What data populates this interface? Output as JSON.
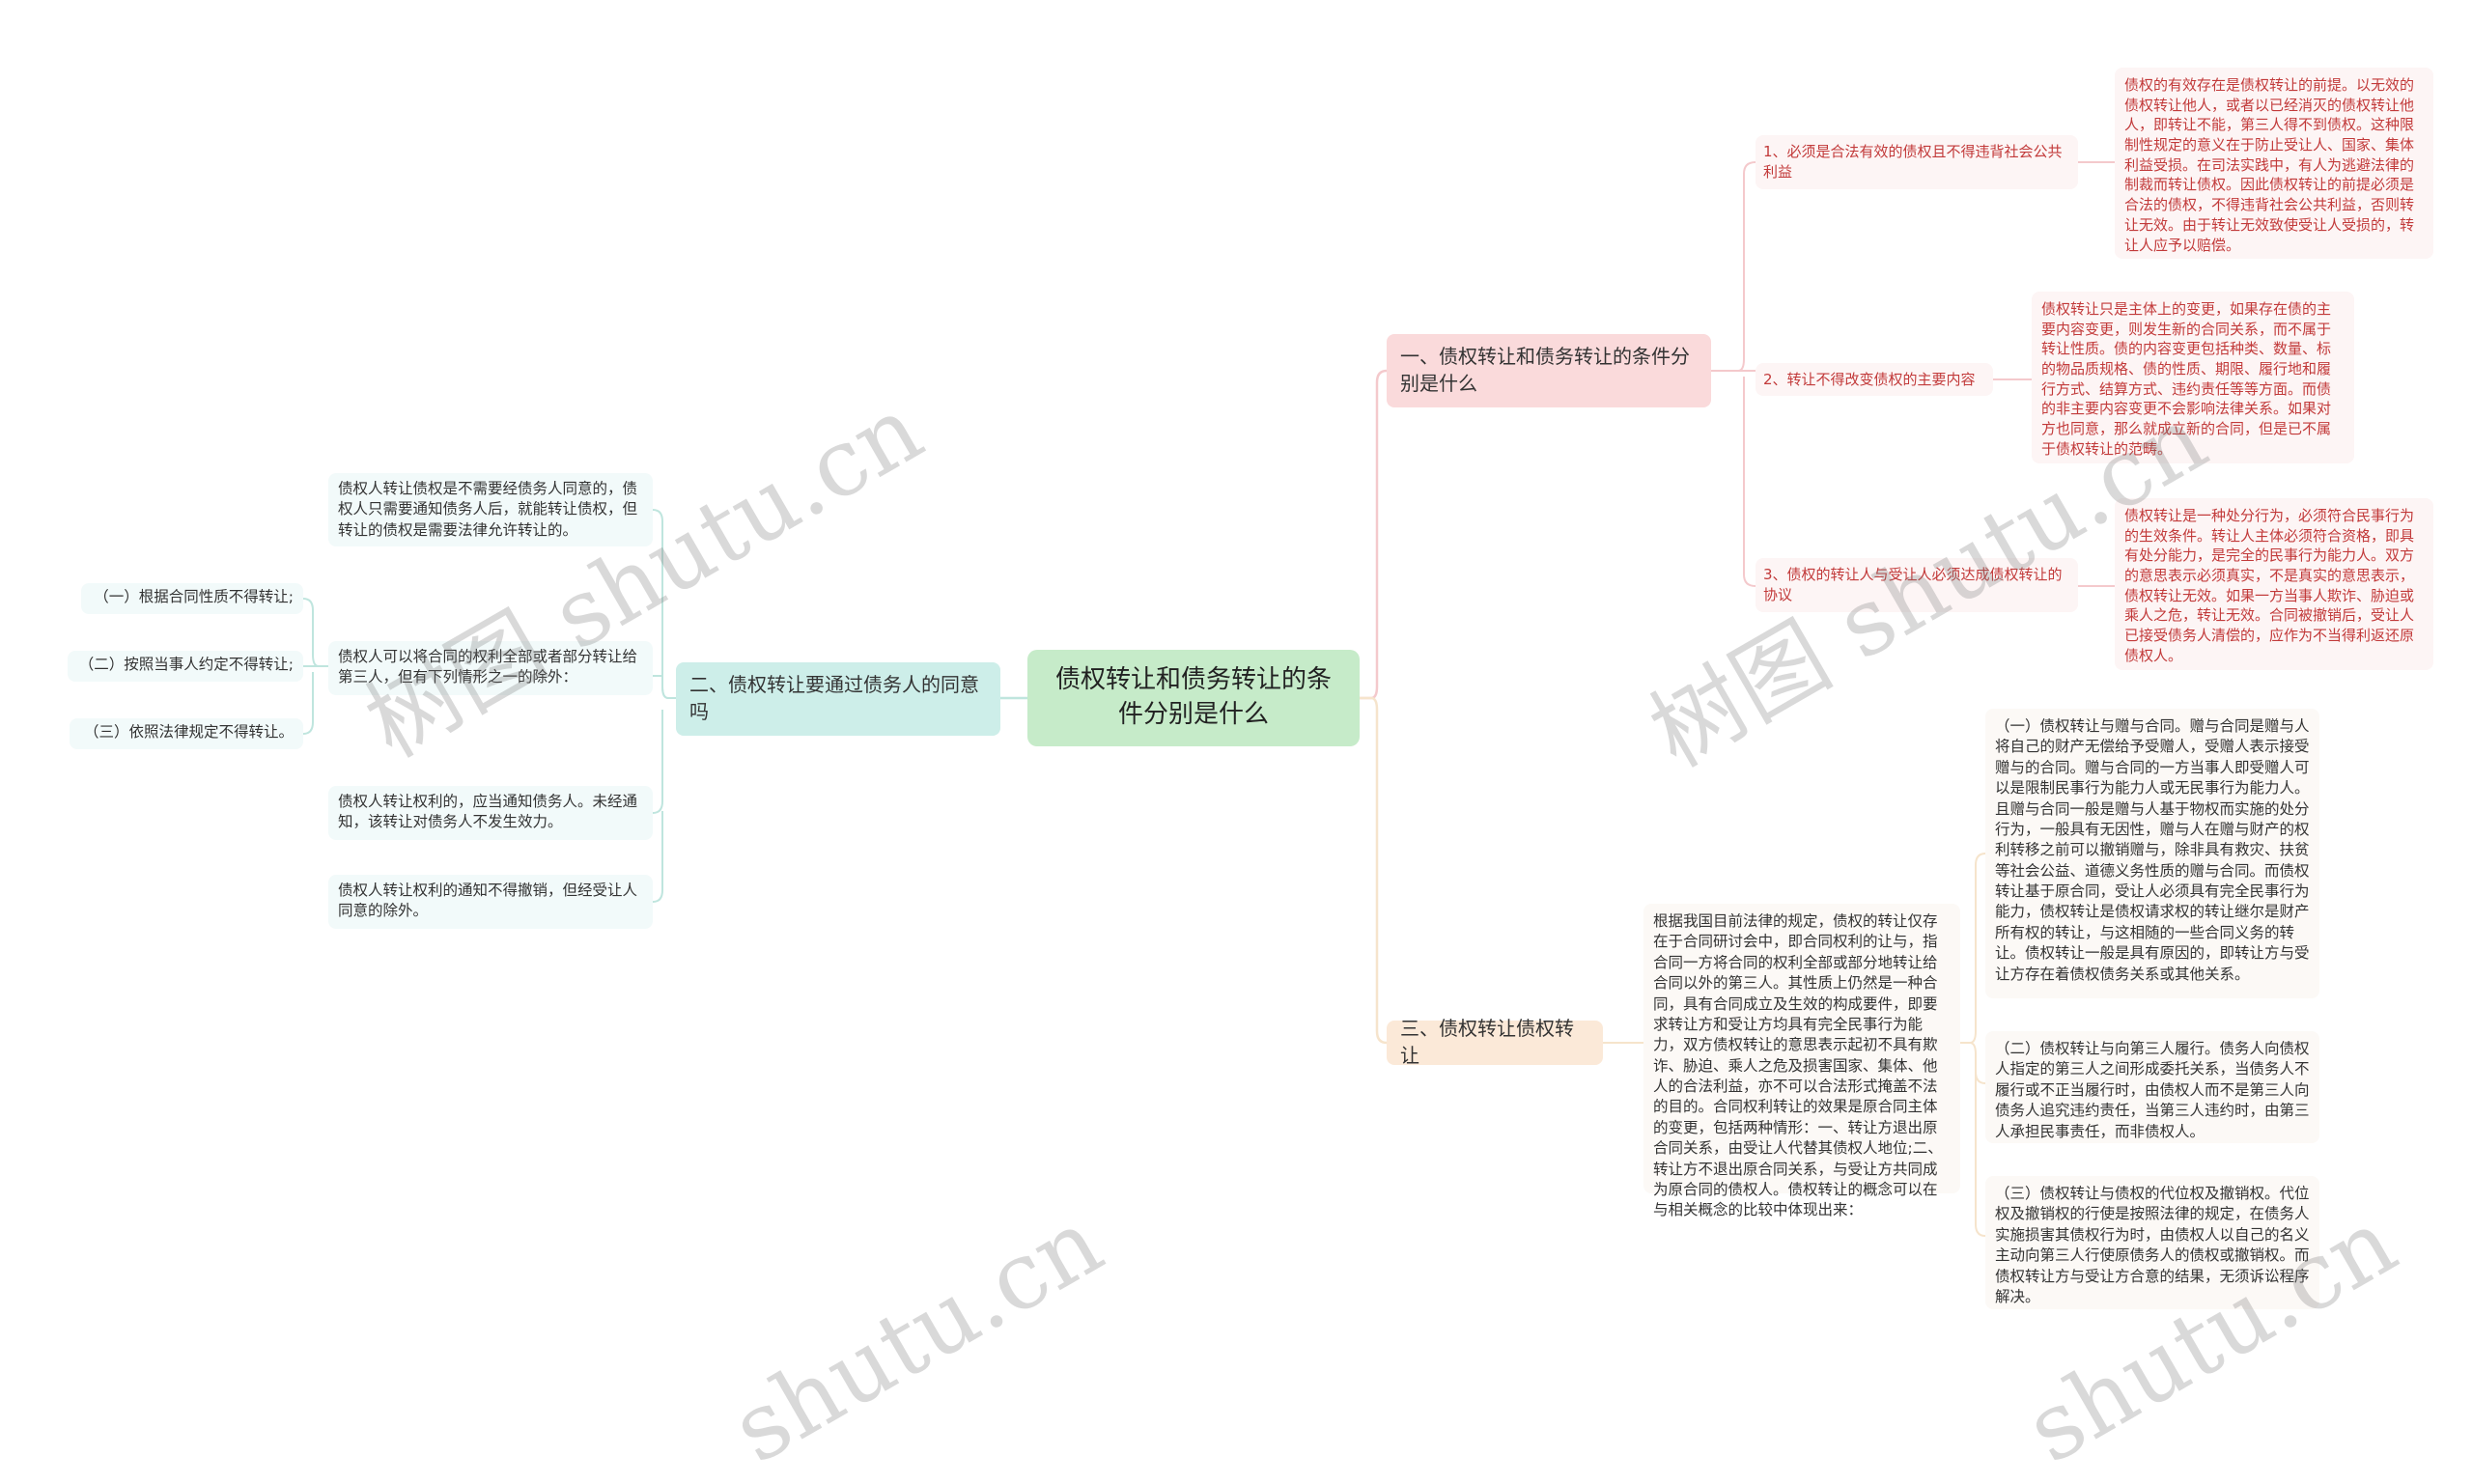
{
  "root": {
    "title": "债权转让和债务转让的条件分别是什么"
  },
  "branches": [
    {
      "id": "b1",
      "title": "一、债权转让和债务转让的条件分别是什么",
      "color": "#fadadb",
      "children": [
        {
          "label": "1、必须是合法有效的债权且不得违背社会公共利益",
          "detail": "债权的有效存在是债权转让的前提。以无效的债权转让他人，或者以已经消灭的债权转让他人，即转让不能，第三人得不到债权。这种限制性规定的意义在于防止受让人、国家、集体利益受损。在司法实践中，有人为逃避法律的制裁而转让债权。因此债权转让的前提必须是合法的债权，不得违背社会公共利益，否则转让无效。由于转让无效致使受让人受损的，转让人应予以赔偿。"
        },
        {
          "label": "2、转让不得改变债权的主要内容",
          "detail": "债权转让只是主体上的变更，如果存在债的主要内容变更，则发生新的合同关系，而不属于转让性质。债的内容变更包括种类、数量、标的物品质规格、债的性质、期限、履行地和履行方式、结算方式、违约责任等等方面。而债的非主要内容变更不会影响法律关系。如果对方也同意，那么就成立新的合同，但是已不属于债权转让的范畴。"
        },
        {
          "label": "3、债权的转让人与受让人必须达成债权转让的协议",
          "detail": "债权转让是一种处分行为，必须符合民事行为的生效条件。转让人主体必须符合资格，即具有处分能力，是完全的民事行为能力人。双方的意思表示必须真实，不是真实的意思表示，债权转让无效。如果一方当事人欺诈、胁迫或乘人之危，转让无效。合同被撤销后，受让人已接受债务人清偿的，应作为不当得利返还原债权人。"
        }
      ]
    },
    {
      "id": "b2",
      "title": "二、债权转让要通过债务人的同意吗",
      "color": "#cdeee9",
      "children": [
        {
          "label": "债权人转让债权是不需要经债务人同意的，债权人只需要通知债务人后，就能转让债权，但转让的债权是需要法律允许转让的。"
        },
        {
          "label": "债权人可以将合同的权利全部或者部分转让给第三人，但有下列情形之一的除外：",
          "sub": [
            "（一）根据合同性质不得转让;",
            "（二）按照当事人约定不得转让;",
            "（三）依照法律规定不得转让。"
          ]
        },
        {
          "label": "债权人转让权利的，应当通知债务人。未经通知，该转让对债务人不发生效力。"
        },
        {
          "label": "债权人转让权利的通知不得撤销，但经受让人同意的除外。"
        }
      ]
    },
    {
      "id": "b3",
      "title": "三、债权转让债权转让",
      "color": "#fbe9d8",
      "intro": "根据我国目前法律的规定，债权的转让仅存在于合同研讨会中，即合同权利的让与，指合同一方将合同的权利全部或部分地转让给合同以外的第三人。其性质上仍然是一种合同，具有合同成立及生效的构成要件，即要求转让方和受让方均具有完全民事行为能力，双方债权转让的意思表示起初不具有欺诈、胁迫、乘人之危及损害国家、集体、他人的合法利益，亦不可以合法形式掩盖不法的目的。合同权利转让的效果是原合同主体的变更，包括两种情形：一、转让方退出原合同关系，由受让人代替其债权人地位;二、转让方不退出原合同关系，与受让方共同成为原合同的债权人。债权转让的概念可以在与相关概念的比较中体现出来：",
      "children": [
        {
          "label": "（一）债权转让与赠与合同。赠与合同是赠与人将自己的财产无偿给予受赠人，受赠人表示接受赠与的合同。赠与合同的一方当事人即受赠人可以是限制民事行为能力人或无民事行为能力人。且赠与合同一般是赠与人基于物权而实施的处分行为，一般具有无因性，赠与人在赠与财产的权利转移之前可以撤销赠与，除非具有救灾、扶贫等社会公益、道德义务性质的赠与合同。而债权转让基于原合同，受让人必须具有完全民事行为能力，债权转让是债权请求权的转让继尔是财产所有权的转让，与这相随的一些合同义务的转让。债权转让一般是具有原因的，即转让方与受让方存在着债权债务关系或其他关系。"
        },
        {
          "label": "（二）债权转让与向第三人履行。债务人向债权人指定的第三人之间形成委托关系，当债务人不履行或不正当履行时，由债权人而不是第三人向债务人追究违约责任，当第三人违约时，由第三人承担民事责任，而非债权人。"
        },
        {
          "label": "（三）债权转让与债权的代位权及撤销权。代位权及撤销权的行使是按照法律的规定，在债务人实施损害其债权行为时，由债权人以自己的名义主动向第三人行使原债务人的债权或撤销权。而债权转让方与受让方合意的结果，无须诉讼程序解决。"
        }
      ]
    }
  ],
  "colors": {
    "root_bg": "#c6ebc9",
    "pink_line": "#f4c9cc",
    "teal_line": "#bfe5de",
    "beige_line": "#f6e4cc",
    "red_text": "#c23a3a"
  },
  "watermarks": [
    "树图 shutu.cn",
    "树图 shutu.cn",
    "shutu.cn",
    "shutu.cn"
  ]
}
